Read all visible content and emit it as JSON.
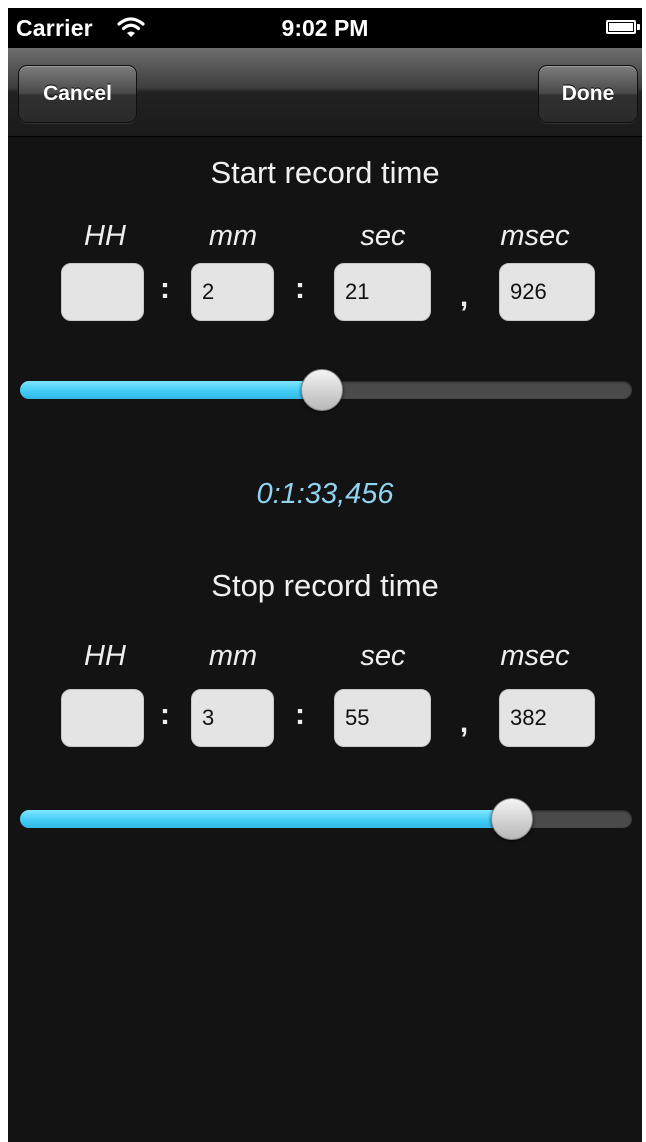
{
  "status_bar": {
    "carrier": "Carrier",
    "time": "9:02 PM"
  },
  "nav": {
    "cancel_label": "Cancel",
    "done_label": "Done"
  },
  "start": {
    "title": "Start record time",
    "units": {
      "hh": "HH",
      "mm": "mm",
      "sec": "sec",
      "msec": "msec"
    },
    "values": {
      "hh": "",
      "mm": "2",
      "sec": "21",
      "msec": "926"
    },
    "separators": [
      ":",
      ":",
      ","
    ],
    "slider_level": 0.494
  },
  "duration": "0:1:33,456",
  "stop": {
    "title": "Stop record time",
    "units": {
      "hh": "HH",
      "mm": "mm",
      "sec": "sec",
      "msec": "msec"
    },
    "values": {
      "hh": "",
      "mm": "3",
      "sec": "55",
      "msec": "382"
    },
    "separators": [
      ":",
      ":",
      ","
    ],
    "slider_level": 0.804
  },
  "colors": {
    "accent": "#3fcaf5",
    "duration_text": "#8fd3f0",
    "background": "#131313"
  }
}
